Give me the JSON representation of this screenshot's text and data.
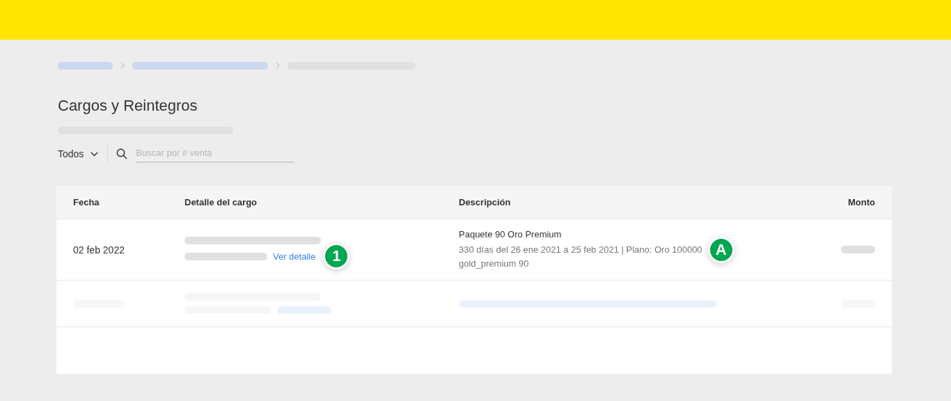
{
  "page": {
    "title": "Cargos y Reintegros"
  },
  "filter": {
    "label": "Todos"
  },
  "search": {
    "placeholder": "Buscar por # venta"
  },
  "table": {
    "columns": [
      "Fecha",
      "Detalle del cargo",
      "Descripción",
      "Monto"
    ],
    "rows": [
      {
        "date": "02 feb 2022",
        "detail_link": "Ver detalle",
        "detail_marker": "1",
        "description_title": "Paquete 90 Oro Premium",
        "description_lines": [
          "330 días del 26 ene 2021 a 25 feb 2021 | Plano: Oro 100000",
          "gold_premium 90"
        ],
        "description_marker": "A"
      }
    ]
  }
}
